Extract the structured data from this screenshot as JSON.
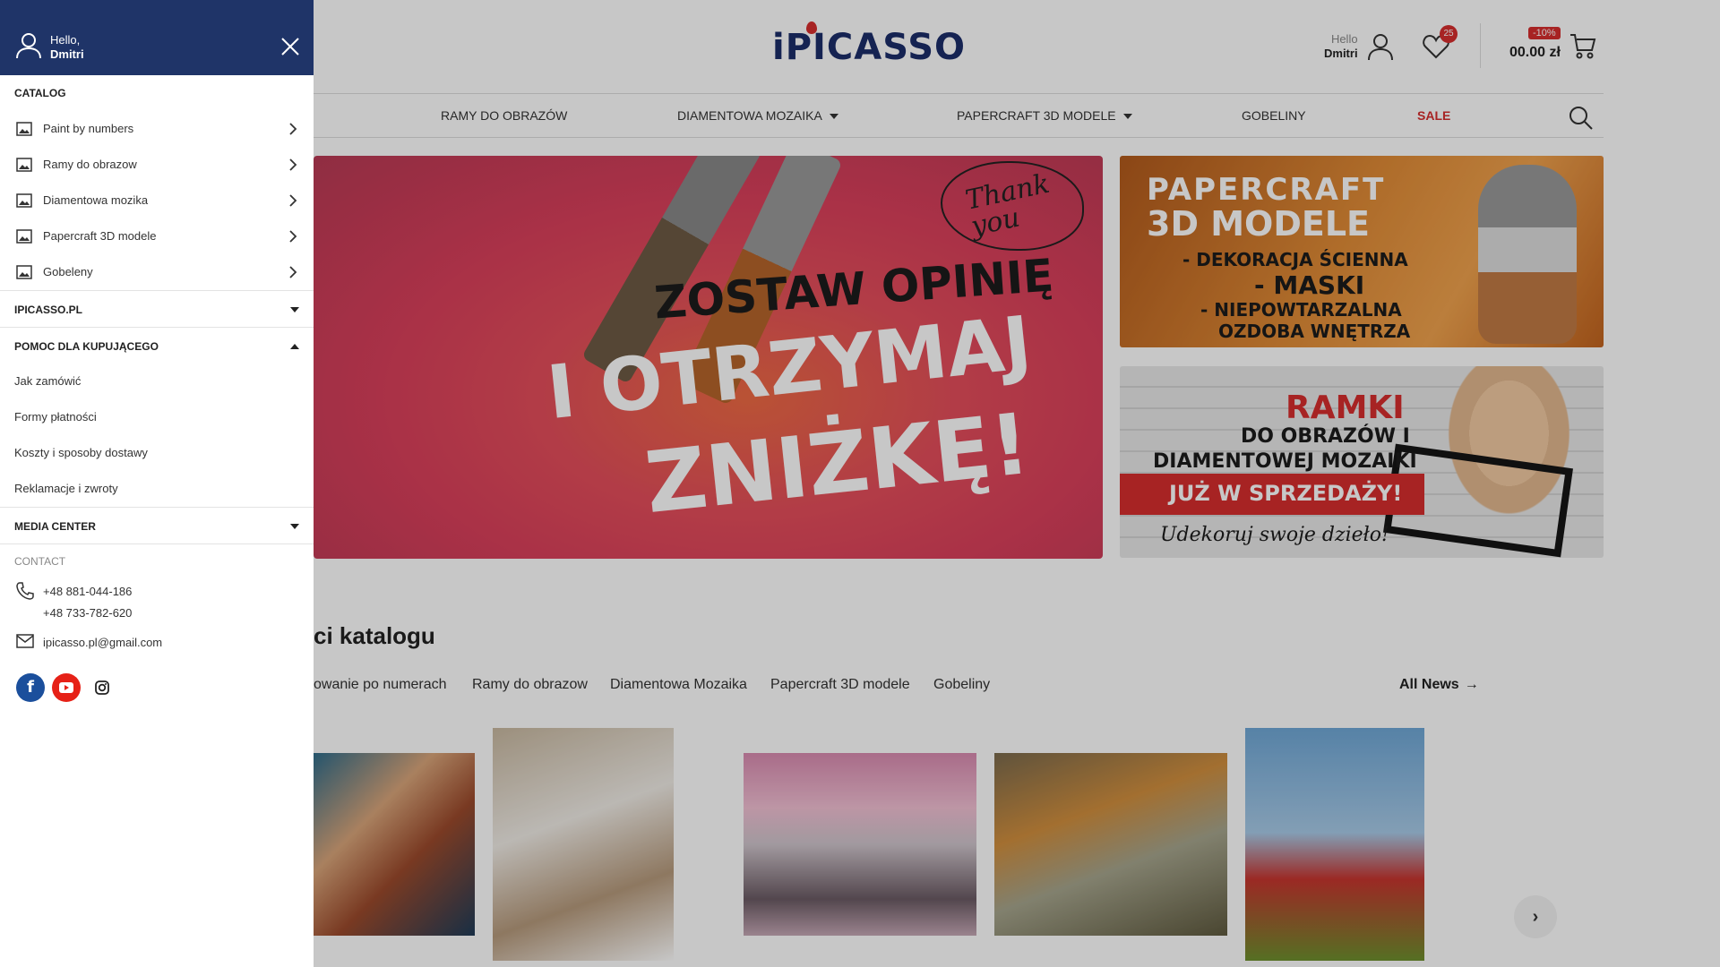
{
  "header": {
    "logo_text": "iPICASSO",
    "greeting": "Hello",
    "user_name": "Dmitri",
    "wishlist_count": "25",
    "cart_discount": "-10%",
    "cart_total": "00.00 zł"
  },
  "nav": {
    "items": [
      {
        "label": "RAMY DO OBRAZÓW",
        "has_dropdown": false
      },
      {
        "label": "DIAMENTOWA MOZAIKA",
        "has_dropdown": true
      },
      {
        "label": "PAPERCRAFT 3D MODELE",
        "has_dropdown": true
      },
      {
        "label": "GOBELINY",
        "has_dropdown": false
      },
      {
        "label": "SALE",
        "has_dropdown": false
      }
    ]
  },
  "banners": {
    "main": {
      "cloud_text": "Thank you",
      "line1": "ZOSTAW OPINIĘ",
      "line2": "I OTRZYMAJ",
      "line3": "ZNIŻKĘ!"
    },
    "papercraft": {
      "line1": "PAPERCRAFT",
      "line2": "3D MODELE",
      "line3": "- DEKORACJA ŚCIENNA",
      "line4": "- MASKI",
      "line5": "- NIEPOWTARZALNA",
      "line6": "OZDOBA WNĘTRZA"
    },
    "ramki": {
      "line1": "RAMKI",
      "line2": "DO OBRAZÓW I",
      "line3": "DIAMENTOWEJ MOZAIKI",
      "line4": "JUŻ W SPRZEDAŻY!",
      "line5": "Udekoruj swoje dzieło!"
    }
  },
  "catalog_section": {
    "title_partial": "ci katalogu",
    "tabs": [
      "owanie po numerach",
      "Ramy do obrazow",
      "Diamentowa Mozaika",
      "Papercraft 3D modele",
      "Gobeliny"
    ],
    "all_news": "All News"
  },
  "drawer": {
    "greeting": "Hello,",
    "user_name": "Dmitri",
    "catalog_label": "CATALOG",
    "catalog_items": [
      "Paint by numbers",
      "Ramy do obrazow",
      "Diamentowa mozika",
      "Papercraft 3D modele",
      "Gobeleny"
    ],
    "acc_ipicasso": "IPICASSO.PL",
    "acc_help": "POMOC DLA KUPUJĄCEGO",
    "help_links": [
      "Jak zamówić",
      "Formy płatności",
      "Koszty i sposoby dostawy",
      "Reklamacje i zwroty"
    ],
    "acc_media": "MEDIA CENTER",
    "contact_label": "CONTACT",
    "phone1": "+48 881-044-186",
    "phone2": "+48 733-782-620",
    "email": "ipicasso.pl@gmail.com"
  },
  "colors": {
    "brand_navy": "#1f3468",
    "accent_red": "#d62d2d"
  }
}
